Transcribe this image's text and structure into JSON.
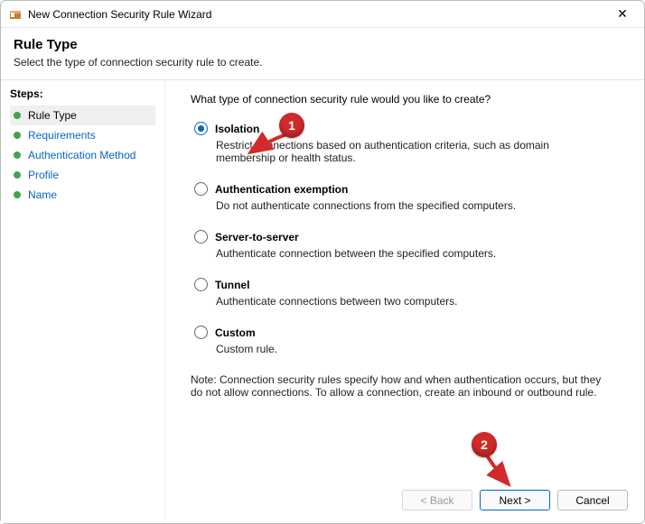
{
  "window": {
    "title": "New Connection Security Rule Wizard",
    "close_glyph": "✕"
  },
  "header": {
    "title": "Rule Type",
    "subtitle": "Select the type of connection security rule to create."
  },
  "sidebar": {
    "label": "Steps:",
    "items": [
      {
        "label": "Rule Type",
        "current": true
      },
      {
        "label": "Requirements",
        "current": false
      },
      {
        "label": "Authentication Method",
        "current": false
      },
      {
        "label": "Profile",
        "current": false
      },
      {
        "label": "Name",
        "current": false
      }
    ]
  },
  "content": {
    "question": "What type of connection security rule would you like to create?",
    "options": [
      {
        "label": "Isolation",
        "desc": "Restrict connections based on authentication criteria, such as domain membership or health status.",
        "selected": true
      },
      {
        "label": "Authentication exemption",
        "desc": "Do not authenticate connections from the specified computers.",
        "selected": false
      },
      {
        "label": "Server-to-server",
        "desc": "Authenticate connection between the specified computers.",
        "selected": false
      },
      {
        "label": "Tunnel",
        "desc": "Authenticate connections between two computers.",
        "selected": false
      },
      {
        "label": "Custom",
        "desc": "Custom rule.",
        "selected": false
      }
    ],
    "note": "Note:  Connection security rules specify how and when authentication occurs, but they do not allow connections.  To allow a connection, create an inbound or outbound rule."
  },
  "buttons": {
    "back": "< Back",
    "next": "Next >",
    "cancel": "Cancel"
  },
  "annotations": {
    "m1": "1",
    "m2": "2"
  }
}
